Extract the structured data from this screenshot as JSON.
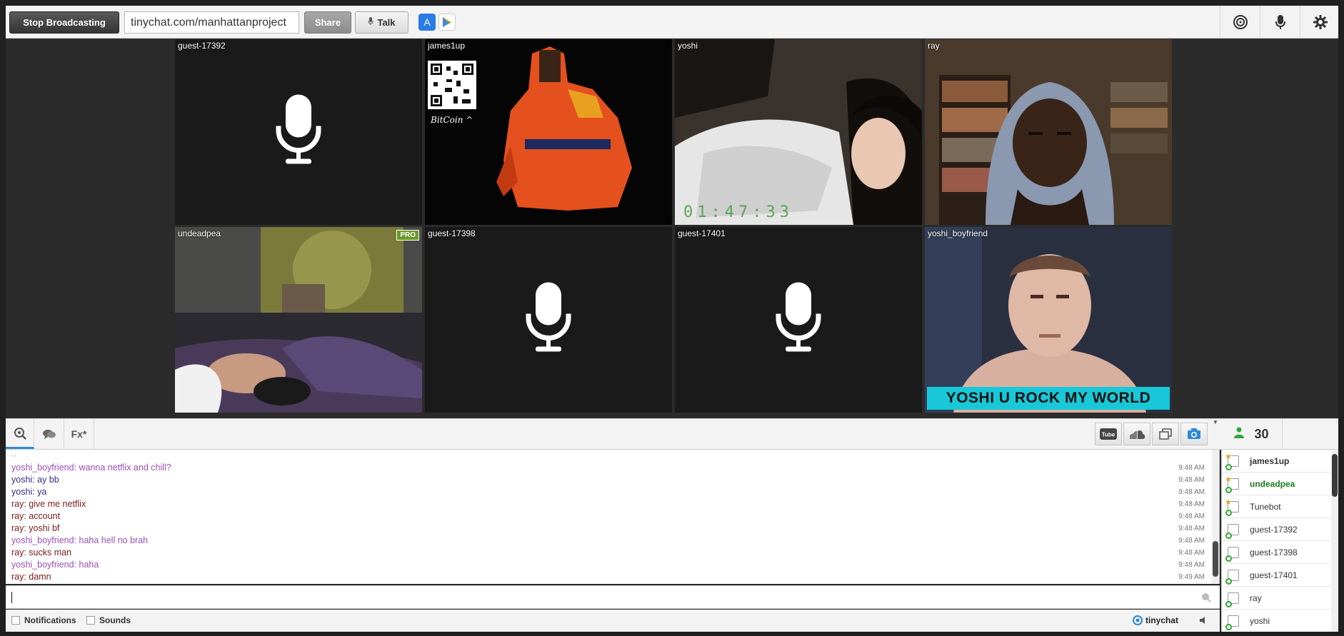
{
  "toolbar": {
    "stop_label": "Stop Broadcasting",
    "url": "tinychat.com/manhattanproject",
    "share_label": "Share",
    "talk_label": "Talk"
  },
  "tiles": [
    {
      "name": "guest-17392",
      "kind": "mic"
    },
    {
      "name": "james1up",
      "kind": "video",
      "overlay_text": "BitCoin ^"
    },
    {
      "name": "yoshi",
      "kind": "video",
      "overlay_text": "01:47:33"
    },
    {
      "name": "ray",
      "kind": "video"
    },
    {
      "name": "undeadpea",
      "kind": "video",
      "badge": "PRO"
    },
    {
      "name": "guest-17398",
      "kind": "mic"
    },
    {
      "name": "guest-17401",
      "kind": "mic"
    },
    {
      "name": "yoshi_boyfriend",
      "kind": "video",
      "caption": "YOSHI U ROCK MY WORLD"
    }
  ],
  "chat_tools": {
    "fx_label": "Fx*",
    "user_count": "30"
  },
  "messages": [
    {
      "text": "yoshi_boyfriend: wanna netflix and chill?",
      "time": "9:48 AM",
      "color": "#9b4fb8"
    },
    {
      "text": "yoshi: ay bb",
      "time": "9:48 AM",
      "color": "#3a2a80"
    },
    {
      "text": "yoshi: ya",
      "time": "9:48 AM",
      "color": "#3a2a80"
    },
    {
      "text": "ray: give me netflix",
      "time": "9:48 AM",
      "color": "#7a1a1a"
    },
    {
      "text": "ray: account",
      "time": "9:48 AM",
      "color": "#7a1a1a"
    },
    {
      "text": "ray: yoshi bf",
      "time": "9:48 AM",
      "color": "#7a1a1a"
    },
    {
      "text": "yoshi_boyfriend: haha hell no brah",
      "time": "9:48 AM",
      "color": "#9b4fb8"
    },
    {
      "text": "ray: sucks man",
      "time": "9:48 AM",
      "color": "#7a1a1a"
    },
    {
      "text": "yoshi_boyfriend: haha",
      "time": "9:48 AM",
      "color": "#9b4fb8"
    },
    {
      "text": "ray: damn",
      "time": "9:49 AM",
      "color": "#7a1a1a"
    }
  ],
  "input": {
    "value": "",
    "placeholder": ""
  },
  "footer": {
    "notifications_label": "Notifications",
    "sounds_label": "Sounds",
    "brand": "tinychat"
  },
  "users": [
    {
      "name": "james1up",
      "bold": true,
      "color": "#333333",
      "star": true
    },
    {
      "name": "undeadpea",
      "bold": true,
      "color": "#1e7a1e",
      "star": true
    },
    {
      "name": "Tunebot",
      "bold": false,
      "color": "#333333",
      "star": true
    },
    {
      "name": "guest-17392",
      "bold": false,
      "color": "#333333",
      "star": false
    },
    {
      "name": "guest-17398",
      "bold": false,
      "color": "#333333",
      "star": false
    },
    {
      "name": "guest-17401",
      "bold": false,
      "color": "#333333",
      "star": false
    },
    {
      "name": "ray",
      "bold": false,
      "color": "#333333",
      "star": false
    },
    {
      "name": "yoshi",
      "bold": false,
      "color": "#333333",
      "star": false
    }
  ]
}
